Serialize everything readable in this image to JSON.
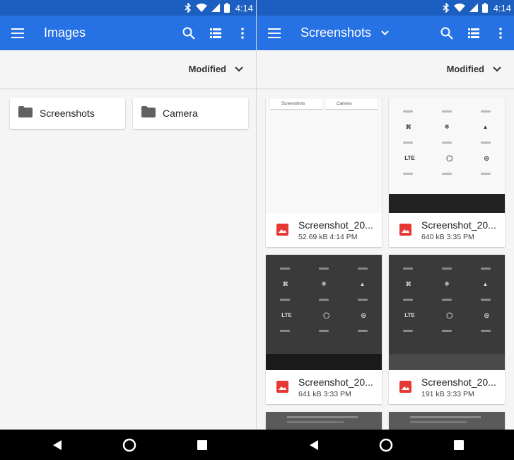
{
  "status": {
    "time": "4:14"
  },
  "left": {
    "title": "Images",
    "sort_label": "Modified",
    "folders": [
      {
        "name": "Screenshots",
        "icon": "folder-icon"
      },
      {
        "name": "Camera",
        "icon": "folder-icon"
      }
    ]
  },
  "right": {
    "title": "Screenshots",
    "sort_label": "Modified",
    "mini_folders": [
      "Screenshots",
      "Camera"
    ],
    "qs_labels": [
      "LTE"
    ],
    "files": [
      {
        "name": "Screenshot_20...",
        "meta": "52.69 kB 4:14 PM",
        "icon": "image-icon"
      },
      {
        "name": "Screenshot_20...",
        "meta": "640 kB 3:35 PM",
        "icon": "image-icon"
      },
      {
        "name": "Screenshot_20...",
        "meta": "641 kB 3:33 PM",
        "icon": "image-icon"
      },
      {
        "name": "Screenshot_20...",
        "meta": "191 kB 3:33 PM",
        "icon": "image-icon"
      }
    ]
  },
  "colors": {
    "statusbar": "#1c5fc0",
    "appbar": "#2671e4",
    "image_icon": "#e53935",
    "folder_icon": "#616161"
  },
  "nav": {
    "back_icon": "back-triangle-icon",
    "home_icon": "home-circle-icon",
    "recents_icon": "recents-square-icon"
  }
}
